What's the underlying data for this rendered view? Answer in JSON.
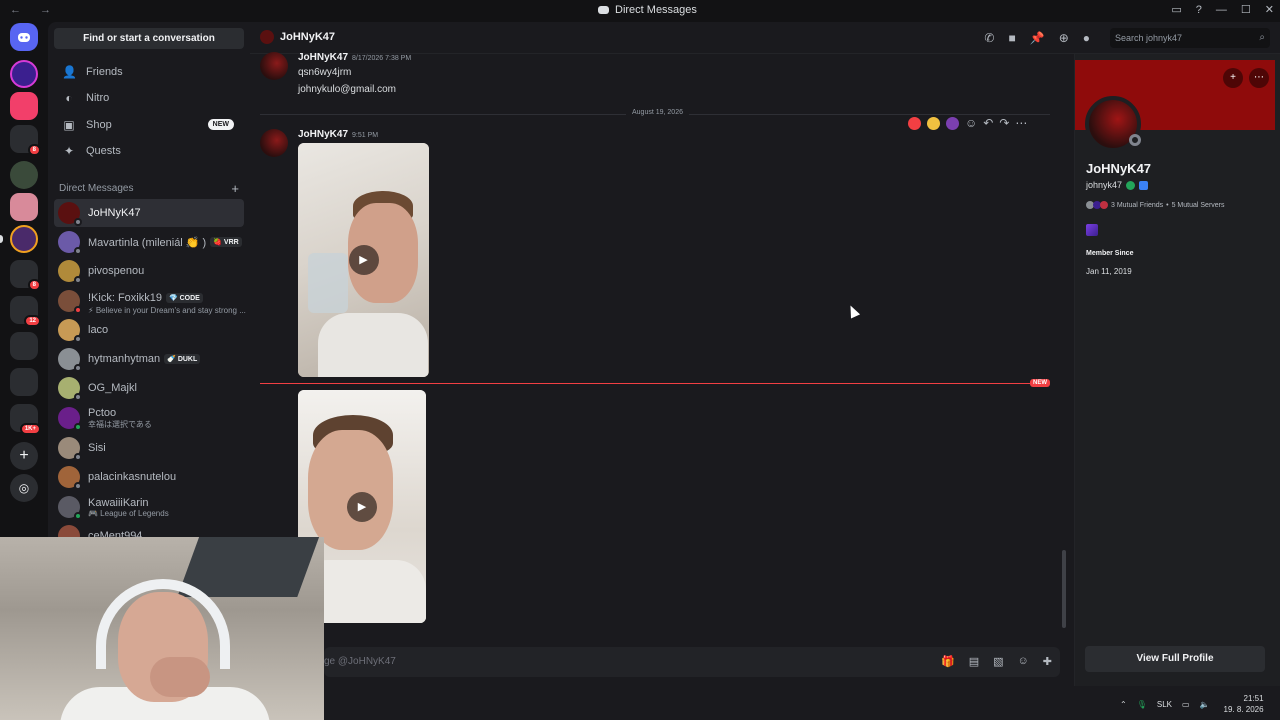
{
  "window": {
    "nav_arrows": "← →",
    "title": "Direct Messages"
  },
  "sidebar": {
    "find_button": "Find or start a conversation",
    "nav": [
      {
        "label": "Friends",
        "icon": "friends-icon"
      },
      {
        "label": "Nitro",
        "icon": "nitro-icon"
      },
      {
        "label": "Shop",
        "icon": "shop-icon",
        "badge": "NEW"
      },
      {
        "label": "Quests",
        "icon": "quests-icon"
      }
    ],
    "dm_header": "Direct Messages",
    "dms": [
      {
        "name": "JoHNyK47",
        "active": true,
        "status": "offline",
        "color": "#5a1010"
      },
      {
        "name": "Mavartinla (mileniál 👏 )",
        "tag": "🍓 VRR",
        "status": "offline",
        "color": "#6b5aa8"
      },
      {
        "name": "pivospenou",
        "status": "offline",
        "color": "#b08a3a"
      },
      {
        "name": "!Kick: Foxikk19",
        "tag": "💎 CODE",
        "sub": "⚡ Believe in your Dream's and stay strong ...",
        "status": "dnd",
        "color": "#7a4e3a"
      },
      {
        "name": "laco",
        "status": "offline",
        "color": "#c79a55"
      },
      {
        "name": "hytmanhytman",
        "tag": "🍼 DUKL",
        "status": "offline",
        "color": "#8a8f94"
      },
      {
        "name": "OG_Majkl",
        "status": "offline",
        "color": "#a7b070"
      },
      {
        "name": "Pctoo",
        "sub": "幸福は選択である",
        "status": "online",
        "color": "#6a1f8a"
      },
      {
        "name": "Sisi",
        "status": "offline",
        "color": "#9a8a7a"
      },
      {
        "name": "palacinkasnutelou",
        "status": "offline",
        "color": "#a0643a"
      },
      {
        "name": "KawaiiiKarin",
        "sub": "🎮 League of Legends",
        "status": "online",
        "color": "#5a5a64"
      },
      {
        "name": "ceMent994",
        "status": "offline",
        "color": "#8a4a3a"
      }
    ]
  },
  "chat": {
    "recipient": "JoHNyK47",
    "search_placeholder": "Search johnyk47",
    "messages": [
      {
        "author": "JoHNyK47",
        "time": "8/17/2026 7:38 PM",
        "lines": [
          "qsn6wy4jrm",
          "johnykulo@gmail.com"
        ]
      },
      {
        "author": "JoHNyK47",
        "time": "9:51 PM"
      }
    ],
    "date_divider": "August 19, 2026",
    "new_marker": "NEW",
    "composer_placeholder": "ge @JoHNyK47"
  },
  "profile": {
    "display_name": "JoHNyK47",
    "username": "johnyk47",
    "mutual_friends": "3 Mutual Friends",
    "mutual_servers": "5 Mutual Servers",
    "member_since_label": "Member Since",
    "member_since": "Jan 11, 2019",
    "view_full": "View Full Profile",
    "banner_color": "#8f0b0b"
  },
  "rail": {
    "badges": [
      "8",
      "8",
      "12",
      "1K+"
    ]
  },
  "tray": {
    "lang": "SLK",
    "time": "21:51",
    "date": "19. 8. 2026"
  }
}
